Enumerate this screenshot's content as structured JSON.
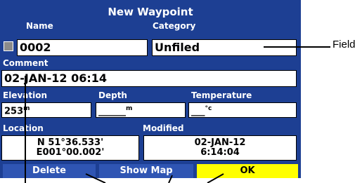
{
  "title": "New Waypoint",
  "name": {
    "label": "Name",
    "value": "0002"
  },
  "category": {
    "label": "Category",
    "value": "Unfiled"
  },
  "comment": {
    "label": "Comment",
    "value": "02-JAN-12 06:14"
  },
  "elevation": {
    "label": "Elevation",
    "value": "253",
    "unit": "m"
  },
  "depth": {
    "label": "Depth",
    "value": "______",
    "unit": "m"
  },
  "temperature": {
    "label": "Temperature",
    "value": "___",
    "unit": "°c"
  },
  "location": {
    "label": "Location",
    "lat": "N 51°36.533'",
    "lon": "E001°00.002'"
  },
  "modified": {
    "label": "Modified",
    "date": "02-JAN-12",
    "time": "6:14:04"
  },
  "buttons": {
    "delete": "Delete",
    "show_map": "Show Map",
    "ok": "OK"
  },
  "annotation": {
    "field": "Field"
  },
  "colors": {
    "screen_bg": "#1d3f93",
    "button_bg": "#2f55b3",
    "ok_bg": "#ffff00"
  }
}
